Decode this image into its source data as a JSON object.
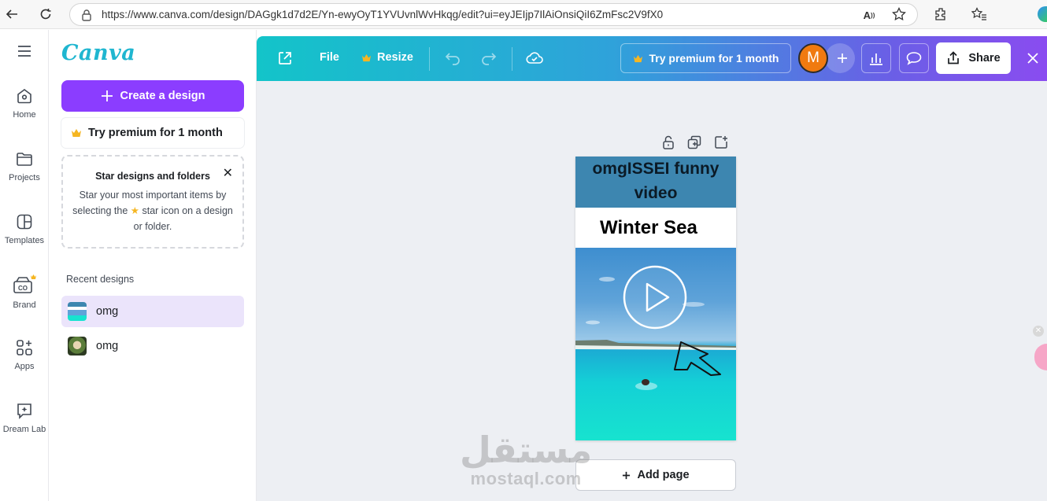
{
  "browser": {
    "url": "https://www.canva.com/design/DAGgk1d7d2E/Yn-ewyOyT1YVUvnlWvHkqg/edit?ui=eyJEIjp7IlAiOnsiQiI6ZmFsc2V9fX0"
  },
  "rail": {
    "items": [
      {
        "label": "Home"
      },
      {
        "label": "Projects"
      },
      {
        "label": "Templates"
      },
      {
        "label": "Brand"
      },
      {
        "label": "Apps"
      },
      {
        "label": "Dream Lab"
      }
    ]
  },
  "panel": {
    "logo": "Canva",
    "create_label": "Create a design",
    "premium_label": "Try premium for 1 month",
    "star_card": {
      "title": "Star designs and folders",
      "body_1": "Star your most important items by selecting the",
      "body_2": "star icon on a design or folder."
    },
    "recent_label": "Recent designs",
    "recent": [
      {
        "name": "omg",
        "active": true
      },
      {
        "name": "omg",
        "active": false
      }
    ]
  },
  "header": {
    "file_label": "File",
    "resize_label": "Resize",
    "try_premium_label": "Try premium for 1 month",
    "avatar_initial": "M",
    "share_label": "Share"
  },
  "design": {
    "title": "omgISSEI funny video",
    "subtitle": "Winter Sea"
  },
  "canvas": {
    "add_page_label": "Add page"
  },
  "watermark": {
    "arabic": "مستقل",
    "latin": "mostaql.com"
  },
  "colors": {
    "accent": "#8b3dff",
    "header_start": "#13c4c9",
    "header_end": "#8a4cf0"
  }
}
